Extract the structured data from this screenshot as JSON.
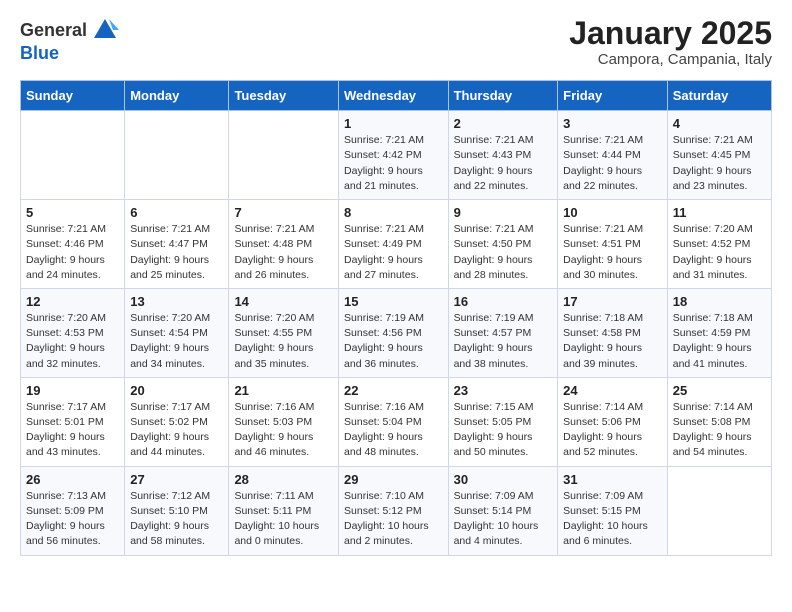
{
  "header": {
    "logo_general": "General",
    "logo_blue": "Blue",
    "month": "January 2025",
    "location": "Campora, Campania, Italy"
  },
  "weekdays": [
    "Sunday",
    "Monday",
    "Tuesday",
    "Wednesday",
    "Thursday",
    "Friday",
    "Saturday"
  ],
  "weeks": [
    [
      {
        "day": "",
        "info": ""
      },
      {
        "day": "",
        "info": ""
      },
      {
        "day": "",
        "info": ""
      },
      {
        "day": "1",
        "info": "Sunrise: 7:21 AM\nSunset: 4:42 PM\nDaylight: 9 hours\nand 21 minutes."
      },
      {
        "day": "2",
        "info": "Sunrise: 7:21 AM\nSunset: 4:43 PM\nDaylight: 9 hours\nand 22 minutes."
      },
      {
        "day": "3",
        "info": "Sunrise: 7:21 AM\nSunset: 4:44 PM\nDaylight: 9 hours\nand 22 minutes."
      },
      {
        "day": "4",
        "info": "Sunrise: 7:21 AM\nSunset: 4:45 PM\nDaylight: 9 hours\nand 23 minutes."
      }
    ],
    [
      {
        "day": "5",
        "info": "Sunrise: 7:21 AM\nSunset: 4:46 PM\nDaylight: 9 hours\nand 24 minutes."
      },
      {
        "day": "6",
        "info": "Sunrise: 7:21 AM\nSunset: 4:47 PM\nDaylight: 9 hours\nand 25 minutes."
      },
      {
        "day": "7",
        "info": "Sunrise: 7:21 AM\nSunset: 4:48 PM\nDaylight: 9 hours\nand 26 minutes."
      },
      {
        "day": "8",
        "info": "Sunrise: 7:21 AM\nSunset: 4:49 PM\nDaylight: 9 hours\nand 27 minutes."
      },
      {
        "day": "9",
        "info": "Sunrise: 7:21 AM\nSunset: 4:50 PM\nDaylight: 9 hours\nand 28 minutes."
      },
      {
        "day": "10",
        "info": "Sunrise: 7:21 AM\nSunset: 4:51 PM\nDaylight: 9 hours\nand 30 minutes."
      },
      {
        "day": "11",
        "info": "Sunrise: 7:20 AM\nSunset: 4:52 PM\nDaylight: 9 hours\nand 31 minutes."
      }
    ],
    [
      {
        "day": "12",
        "info": "Sunrise: 7:20 AM\nSunset: 4:53 PM\nDaylight: 9 hours\nand 32 minutes."
      },
      {
        "day": "13",
        "info": "Sunrise: 7:20 AM\nSunset: 4:54 PM\nDaylight: 9 hours\nand 34 minutes."
      },
      {
        "day": "14",
        "info": "Sunrise: 7:20 AM\nSunset: 4:55 PM\nDaylight: 9 hours\nand 35 minutes."
      },
      {
        "day": "15",
        "info": "Sunrise: 7:19 AM\nSunset: 4:56 PM\nDaylight: 9 hours\nand 36 minutes."
      },
      {
        "day": "16",
        "info": "Sunrise: 7:19 AM\nSunset: 4:57 PM\nDaylight: 9 hours\nand 38 minutes."
      },
      {
        "day": "17",
        "info": "Sunrise: 7:18 AM\nSunset: 4:58 PM\nDaylight: 9 hours\nand 39 minutes."
      },
      {
        "day": "18",
        "info": "Sunrise: 7:18 AM\nSunset: 4:59 PM\nDaylight: 9 hours\nand 41 minutes."
      }
    ],
    [
      {
        "day": "19",
        "info": "Sunrise: 7:17 AM\nSunset: 5:01 PM\nDaylight: 9 hours\nand 43 minutes."
      },
      {
        "day": "20",
        "info": "Sunrise: 7:17 AM\nSunset: 5:02 PM\nDaylight: 9 hours\nand 44 minutes."
      },
      {
        "day": "21",
        "info": "Sunrise: 7:16 AM\nSunset: 5:03 PM\nDaylight: 9 hours\nand 46 minutes."
      },
      {
        "day": "22",
        "info": "Sunrise: 7:16 AM\nSunset: 5:04 PM\nDaylight: 9 hours\nand 48 minutes."
      },
      {
        "day": "23",
        "info": "Sunrise: 7:15 AM\nSunset: 5:05 PM\nDaylight: 9 hours\nand 50 minutes."
      },
      {
        "day": "24",
        "info": "Sunrise: 7:14 AM\nSunset: 5:06 PM\nDaylight: 9 hours\nand 52 minutes."
      },
      {
        "day": "25",
        "info": "Sunrise: 7:14 AM\nSunset: 5:08 PM\nDaylight: 9 hours\nand 54 minutes."
      }
    ],
    [
      {
        "day": "26",
        "info": "Sunrise: 7:13 AM\nSunset: 5:09 PM\nDaylight: 9 hours\nand 56 minutes."
      },
      {
        "day": "27",
        "info": "Sunrise: 7:12 AM\nSunset: 5:10 PM\nDaylight: 9 hours\nand 58 minutes."
      },
      {
        "day": "28",
        "info": "Sunrise: 7:11 AM\nSunset: 5:11 PM\nDaylight: 10 hours\nand 0 minutes."
      },
      {
        "day": "29",
        "info": "Sunrise: 7:10 AM\nSunset: 5:12 PM\nDaylight: 10 hours\nand 2 minutes."
      },
      {
        "day": "30",
        "info": "Sunrise: 7:09 AM\nSunset: 5:14 PM\nDaylight: 10 hours\nand 4 minutes."
      },
      {
        "day": "31",
        "info": "Sunrise: 7:09 AM\nSunset: 5:15 PM\nDaylight: 10 hours\nand 6 minutes."
      },
      {
        "day": "",
        "info": ""
      }
    ]
  ]
}
